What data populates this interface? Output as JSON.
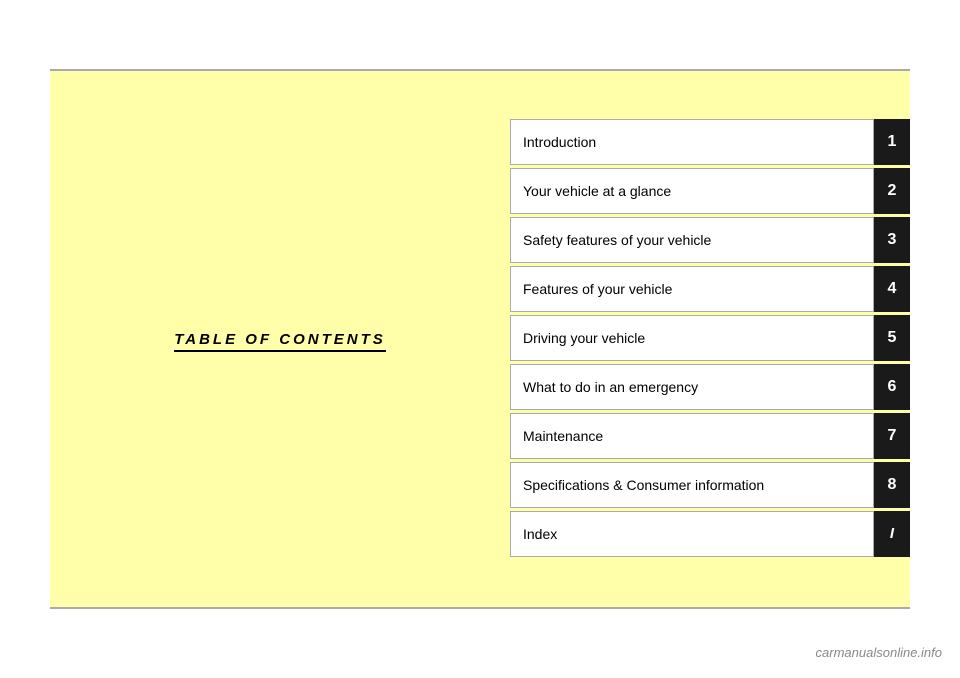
{
  "page": {
    "title": "TABLE OF CONTENTS",
    "watermark": "carmanualsonline.info"
  },
  "toc": {
    "items": [
      {
        "label": "Introduction",
        "number": "1"
      },
      {
        "label": "Your vehicle at a glance",
        "number": "2"
      },
      {
        "label": "Safety features of your vehicle",
        "number": "3"
      },
      {
        "label": "Features of your vehicle",
        "number": "4"
      },
      {
        "label": "Driving your vehicle",
        "number": "5"
      },
      {
        "label": "What to do in an emergency",
        "number": "6"
      },
      {
        "label": "Maintenance",
        "number": "7"
      },
      {
        "label": "Specifications & Consumer information",
        "number": "8"
      },
      {
        "label": "Index",
        "number": "I"
      }
    ]
  }
}
